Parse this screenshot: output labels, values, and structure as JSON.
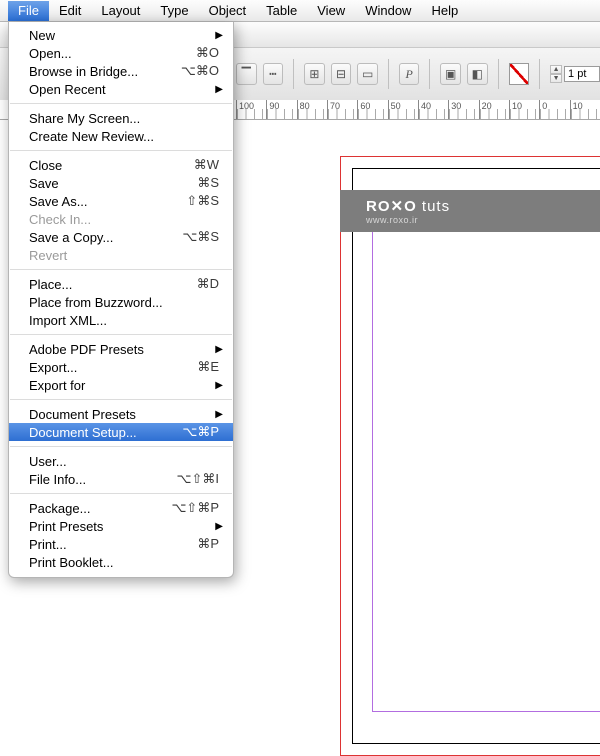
{
  "menubar": {
    "items": [
      "File",
      "Edit",
      "Layout",
      "Type",
      "Object",
      "Table",
      "View",
      "Window",
      "Help"
    ],
    "activeIndex": 0
  },
  "dropdown": {
    "groups": [
      [
        {
          "label": "New",
          "submenu": true
        },
        {
          "label": "Open...",
          "shortcut": "⌘O"
        },
        {
          "label": "Browse in Bridge...",
          "shortcut": "⌥⌘O"
        },
        {
          "label": "Open Recent",
          "submenu": true
        }
      ],
      [
        {
          "label": "Share My Screen..."
        },
        {
          "label": "Create New Review..."
        }
      ],
      [
        {
          "label": "Close",
          "shortcut": "⌘W"
        },
        {
          "label": "Save",
          "shortcut": "⌘S"
        },
        {
          "label": "Save As...",
          "shortcut": "⇧⌘S"
        },
        {
          "label": "Check In...",
          "disabled": true
        },
        {
          "label": "Save a Copy...",
          "shortcut": "⌥⌘S"
        },
        {
          "label": "Revert",
          "disabled": true
        }
      ],
      [
        {
          "label": "Place...",
          "shortcut": "⌘D"
        },
        {
          "label": "Place from Buzzword..."
        },
        {
          "label": "Import XML..."
        }
      ],
      [
        {
          "label": "Adobe PDF Presets",
          "submenu": true
        },
        {
          "label": "Export...",
          "shortcut": "⌘E"
        },
        {
          "label": "Export for",
          "submenu": true
        }
      ],
      [
        {
          "label": "Document Presets",
          "submenu": true
        },
        {
          "label": "Document Setup...",
          "shortcut": "⌥⌘P",
          "highlight": true
        }
      ],
      [
        {
          "label": "User..."
        },
        {
          "label": "File Info...",
          "shortcut": "⌥⇧⌘I"
        }
      ],
      [
        {
          "label": "Package...",
          "shortcut": "⌥⇧⌘P"
        },
        {
          "label": "Print Presets",
          "submenu": true
        },
        {
          "label": "Print...",
          "shortcut": "⌘P"
        },
        {
          "label": "Print Booklet..."
        }
      ]
    ]
  },
  "toolbar": {
    "stroke_field_value": "1 pt",
    "paragraph_letter": "P"
  },
  "ruler": {
    "marks": [
      "100",
      "90",
      "80",
      "70",
      "60",
      "50",
      "40",
      "30",
      "20",
      "10",
      "0",
      "10"
    ]
  },
  "watermark": {
    "brand_bold": "RO✕O",
    "brand_light": " tuts",
    "url": "www.roxo.ir"
  }
}
